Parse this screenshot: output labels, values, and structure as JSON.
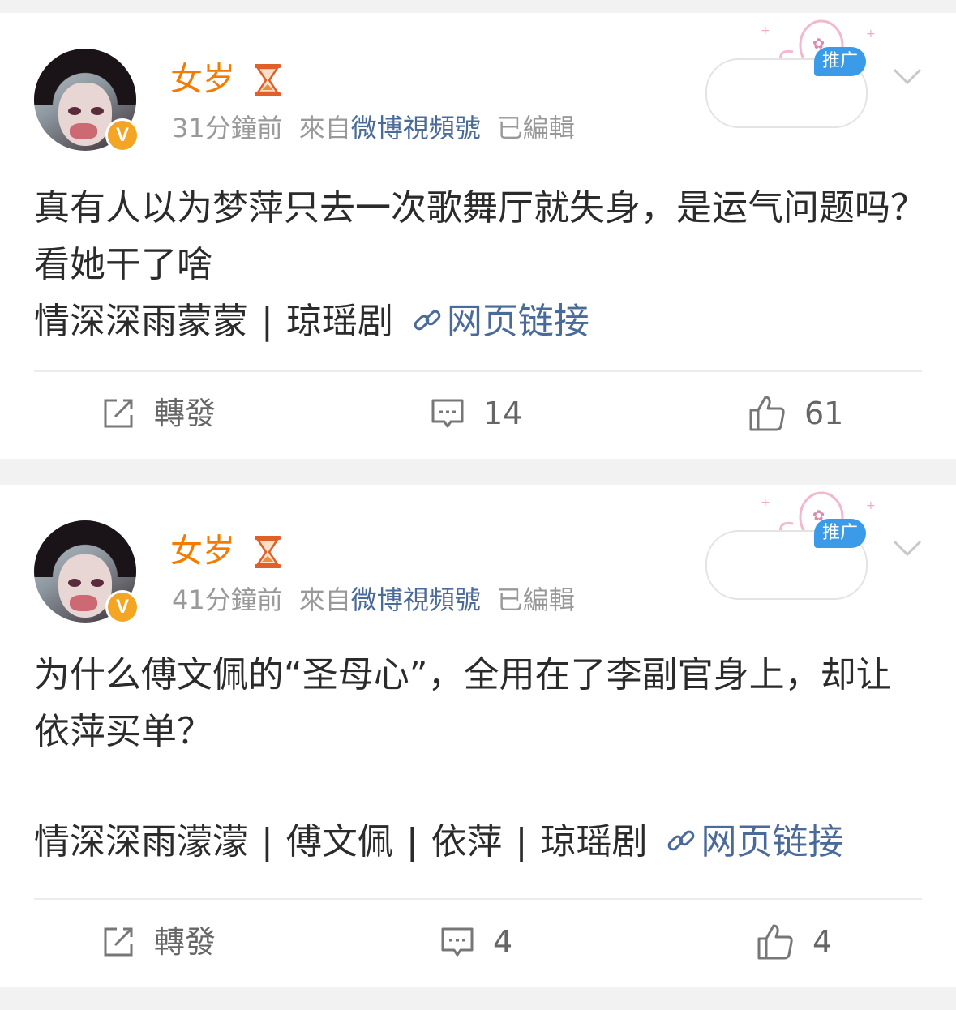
{
  "colors": {
    "username": "#f57b00",
    "link": "#4a6a9a",
    "meta": "#999999",
    "promo_tag": "#3b9be8",
    "verified": "#f3a523"
  },
  "posts": [
    {
      "username": "女岁",
      "verified_symbol": "V",
      "time": "31分鐘前",
      "from_label": "來自",
      "source": "微博視頻號",
      "edited": "已編輯",
      "promo_tag": "推广",
      "text": "真有人以为梦萍只去一次歌舞厅就失身，是运气问题吗？看她干了啥",
      "tags": [
        "情深深雨蒙蒙",
        "琼瑶剧"
      ],
      "separator": "|",
      "link_label": "网页链接",
      "actions": {
        "repost": "轉發",
        "comments": "14",
        "likes": "61"
      }
    },
    {
      "username": "女岁",
      "verified_symbol": "V",
      "time": "41分鐘前",
      "from_label": "來自",
      "source": "微博視頻號",
      "edited": "已編輯",
      "promo_tag": "推广",
      "text": "为什么傅文佩的“圣母心”，全用在了李副官身上，却让依萍买单？",
      "tags": [
        "情深深雨濛濛",
        "傅文佩",
        "依萍",
        "琼瑶剧"
      ],
      "separator": "|",
      "link_label": "网页链接",
      "actions": {
        "repost": "轉發",
        "comments": "4",
        "likes": "4"
      }
    }
  ]
}
